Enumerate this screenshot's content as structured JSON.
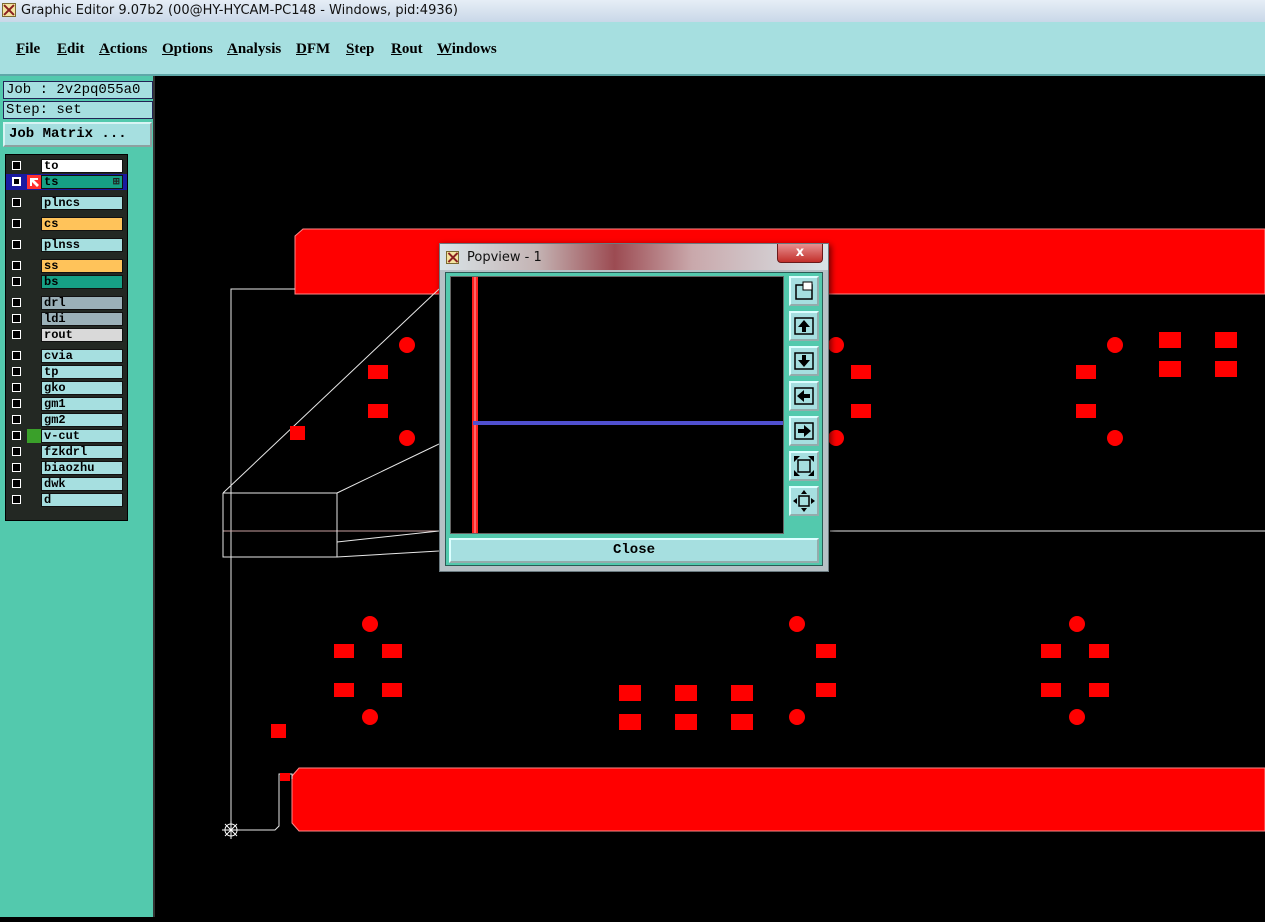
{
  "window": {
    "title": "Graphic Editor 9.07b2 (00@HY-HYCAM-PC148 - Windows, pid:4936)"
  },
  "menu": [
    "File",
    "Edit",
    "Actions",
    "Options",
    "Analysis",
    "DFM",
    "Step",
    "Rout",
    "Windows"
  ],
  "job": {
    "job_label": "Job : 2v2pq055a0",
    "step_label": "Step: set",
    "matrix_button": "Job Matrix ..."
  },
  "layers": [
    {
      "name": "to",
      "color": "#ffffff",
      "active": false
    },
    {
      "name": "ts",
      "color": "#16a085",
      "active": true
    },
    {
      "name": "plncs",
      "color": "#a6dfe0",
      "active": false
    },
    {
      "name": "cs",
      "color": "#ffc35a",
      "active": false
    },
    {
      "name": "plnss",
      "color": "#a6dfe0",
      "active": false
    },
    {
      "name": "ss",
      "color": "#ffc35a",
      "active": false
    },
    {
      "name": "bs",
      "color": "#16a085",
      "active": false
    },
    {
      "name": "drl",
      "color": "#9bb0b8",
      "active": false
    },
    {
      "name": "ldi",
      "color": "#9bb0b8",
      "active": false
    },
    {
      "name": "rout",
      "color": "#d9d9d9",
      "active": false
    },
    {
      "name": "cvia",
      "color": "#a6dfe0",
      "active": false
    },
    {
      "name": "tp",
      "color": "#a6dfe0",
      "active": false
    },
    {
      "name": "gko",
      "color": "#a6dfe0",
      "active": false
    },
    {
      "name": "gm1",
      "color": "#a6dfe0",
      "active": false
    },
    {
      "name": "gm2",
      "color": "#a6dfe0",
      "active": false
    },
    {
      "name": "v-cut",
      "color": "#a6dfe0",
      "active": false,
      "swatch": "#3aa02a"
    },
    {
      "name": "fzkdrl",
      "color": "#a6dfe0",
      "active": false
    },
    {
      "name": "biaozhu",
      "color": "#a6dfe0",
      "active": false
    },
    {
      "name": "dwk",
      "color": "#a6dfe0",
      "active": false
    },
    {
      "name": "d",
      "color": "#a6dfe0",
      "active": false
    }
  ],
  "popview": {
    "title": "Popview - 1",
    "close_x": "x",
    "close_button": "Close",
    "tools": [
      "zoom-window-icon",
      "pan-up-icon",
      "pan-down-icon",
      "pan-left-icon",
      "pan-right-icon",
      "zoom-in-icon",
      "zoom-fit-icon"
    ]
  },
  "colors": {
    "copper": "#ff0000",
    "panel_bg": "#53c9ad",
    "menu_bg": "#a6dfe0",
    "profile_line": "#ffffff",
    "highlight_line": "#5050d0"
  }
}
